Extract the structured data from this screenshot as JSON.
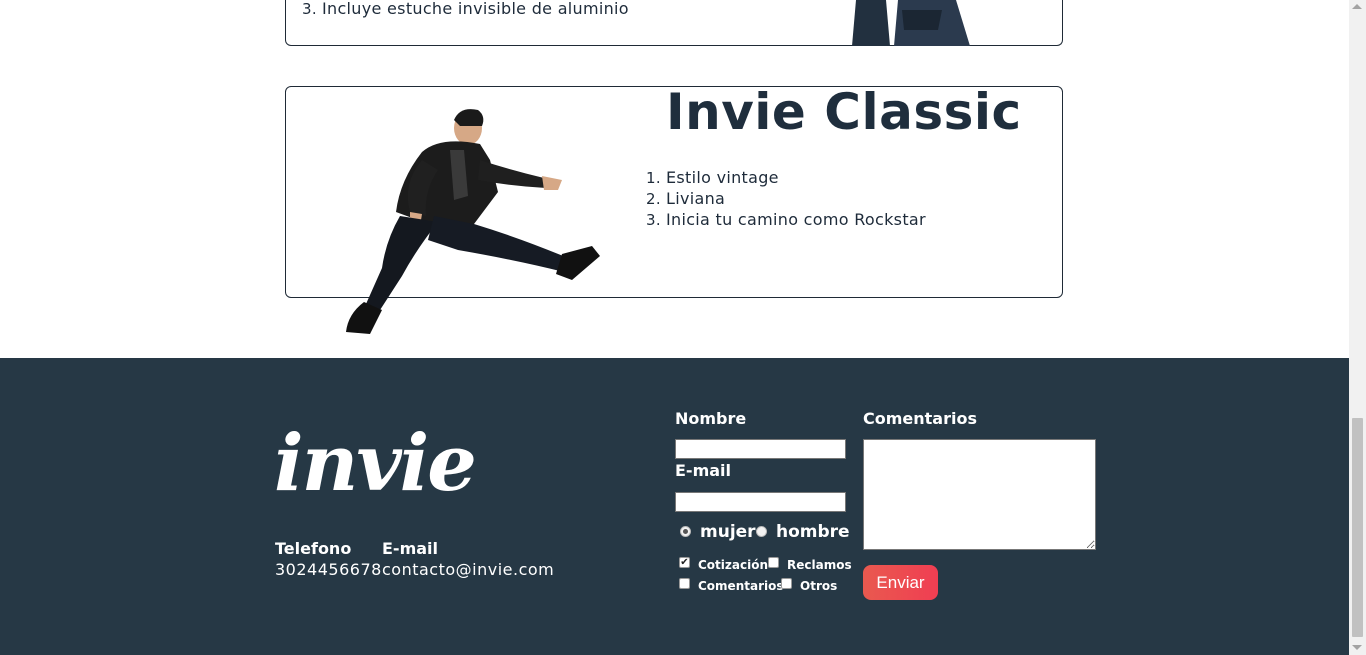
{
  "product_top": {
    "features": [
      "Incluye estuche invisible de aluminio"
    ]
  },
  "product_classic": {
    "title": "Invie Classic",
    "features": [
      "Estilo vintage",
      "Liviana",
      "Inicia tu camino como Rockstar"
    ]
  },
  "footer": {
    "logo_text": "invie",
    "phone_label": "Telefono",
    "phone_value": "3024456678",
    "email_label": "E-mail",
    "email_value": "contacto@invie.com",
    "form": {
      "name_label": "Nombre",
      "email_label": "E-mail",
      "comments_label": "Comentarios",
      "name_value": "",
      "email_value": "",
      "gender_options": [
        {
          "label": "mujer",
          "selected": true
        },
        {
          "label": "hombre",
          "selected": false
        }
      ],
      "topics": [
        {
          "label": "Cotización",
          "checked": true
        },
        {
          "label": "Reclamos",
          "checked": false
        },
        {
          "label": "Comentarios",
          "checked": false
        },
        {
          "label": "Otros",
          "checked": false
        }
      ],
      "send_label": "Enviar"
    }
  },
  "colors": {
    "footer_bg": "#263845",
    "button_start": "#e9594f",
    "button_end": "#f03e52",
    "title": "#1f2e3d"
  }
}
